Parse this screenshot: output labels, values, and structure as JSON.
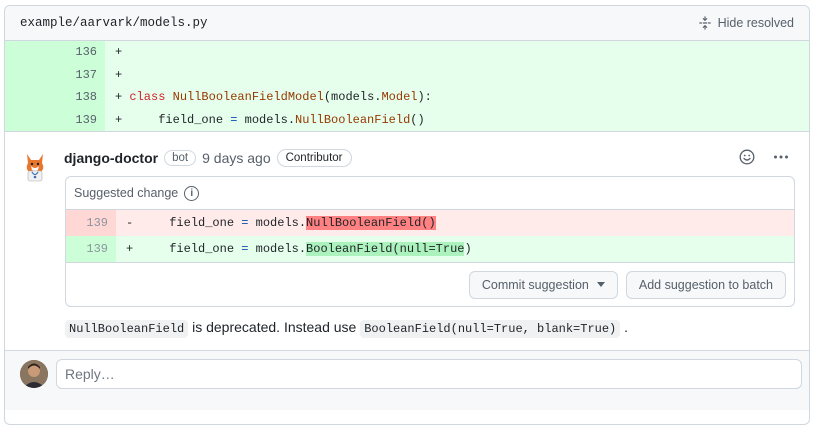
{
  "file": {
    "path": "example/aarvark/models.py",
    "hide_resolved": "Hide resolved"
  },
  "diff": {
    "rows": [
      {
        "line": "136",
        "marker": "+",
        "tokens": []
      },
      {
        "line": "137",
        "marker": "+",
        "tokens": []
      },
      {
        "line": "138",
        "marker": "+",
        "tokens": [
          {
            "t": " ",
            "c": ""
          },
          {
            "t": "class",
            "c": "kw"
          },
          {
            "t": " ",
            "c": ""
          },
          {
            "t": "NullBooleanFieldModel",
            "c": "cls"
          },
          {
            "t": "(models.",
            "c": ""
          },
          {
            "t": "Model",
            "c": "cls"
          },
          {
            "t": "):",
            "c": ""
          }
        ]
      },
      {
        "line": "139",
        "marker": "+",
        "tokens": [
          {
            "t": "     field_one ",
            "c": ""
          },
          {
            "t": "=",
            "c": "op"
          },
          {
            "t": " models.",
            "c": ""
          },
          {
            "t": "NullBooleanField",
            "c": "cls"
          },
          {
            "t": "()",
            "c": ""
          }
        ]
      }
    ]
  },
  "comment": {
    "author": "django-doctor",
    "bot_badge": "bot",
    "time": "9 days ago",
    "role_badge": "Contributor",
    "suggestion_title": "Suggested change",
    "removed": {
      "line": "139",
      "marker": "-",
      "prefix": "     field_one ",
      "eq": "=",
      "mid": " models.",
      "highlight": "NullBooleanField()",
      "suffix": ""
    },
    "added": {
      "line": "139",
      "marker": "+",
      "prefix": "     field_one ",
      "eq": "=",
      "mid": " models.",
      "highlight": "BooleanField(null=True",
      "suffix": ")"
    },
    "commit_button": "Commit suggestion",
    "batch_button": "Add suggestion to batch",
    "body": {
      "code1": "NullBooleanField",
      "text1": " is deprecated. Instead use ",
      "code2": "BooleanField(null=True, blank=True)",
      "text2": " ."
    }
  },
  "reply": {
    "placeholder": "Reply…"
  },
  "colors": {
    "added_bg": "#e6ffec",
    "removed_bg": "#ffebe9",
    "keyword": "#cf222e",
    "class_name": "#953800"
  }
}
